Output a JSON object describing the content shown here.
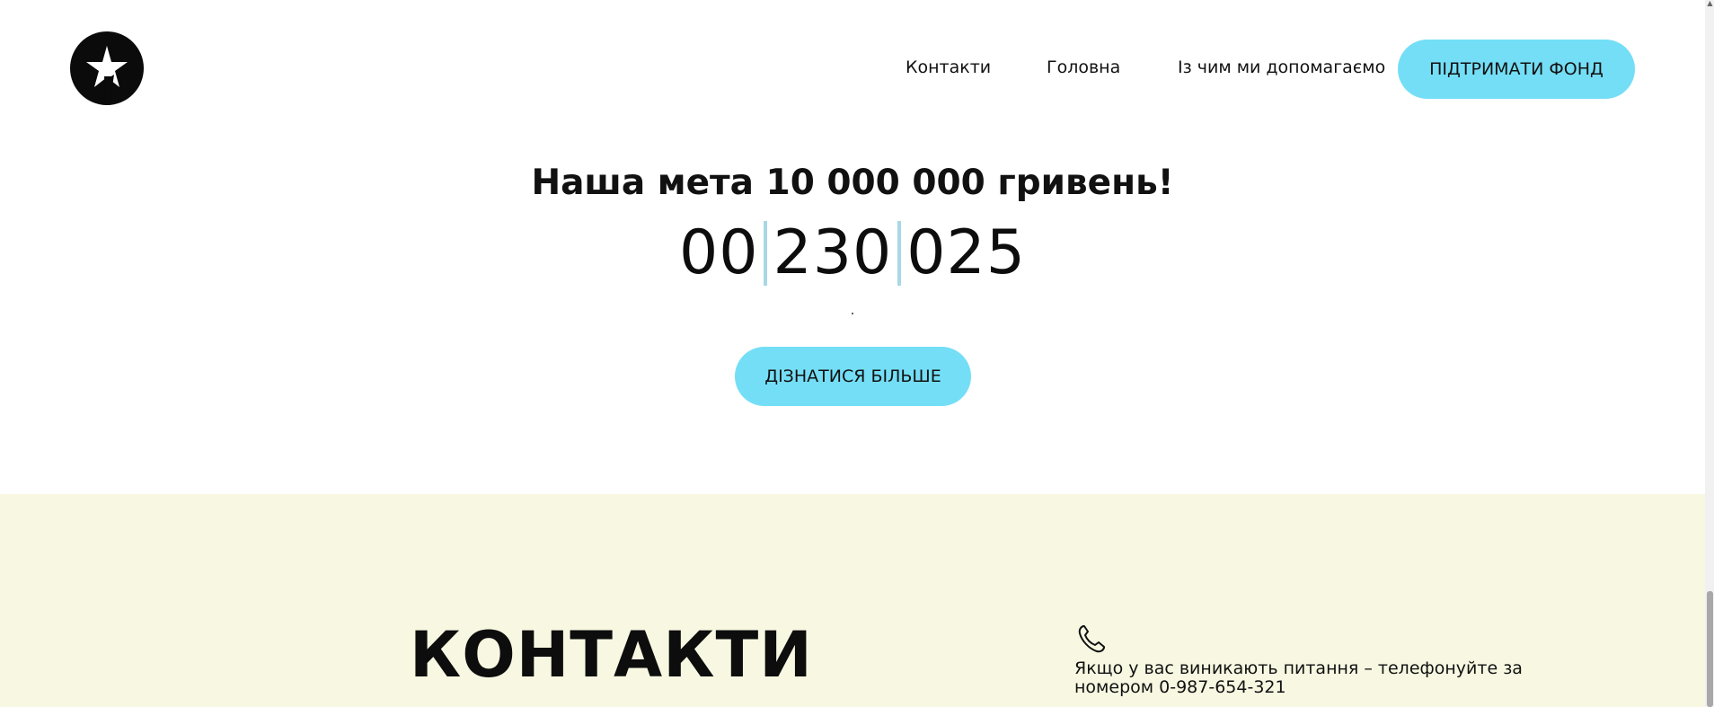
{
  "header": {
    "logo_icon": "star-in-circle-icon",
    "nav": {
      "contacts": "Контакти",
      "home": "Головна",
      "help": "Із чим ми допомагаємо"
    },
    "cta_label": "ПІДТРИМАТИ ФОНД"
  },
  "goal": {
    "title": "Наша мета 10 000 000 гривень!",
    "counter": [
      "00",
      "230",
      "025"
    ],
    "more_label": "ДІЗНАТИСЯ БІЛЬШЕ"
  },
  "contacts": {
    "heading": "КОНТАКТИ",
    "phone_icon": "phone-icon",
    "text": "Якщо у вас виникають питання – телефонуйте за номером 0-987-654-321"
  },
  "colors": {
    "accent": "#74def6",
    "section_bg": "#f8f8e2",
    "separator": "#a8d8e6"
  }
}
